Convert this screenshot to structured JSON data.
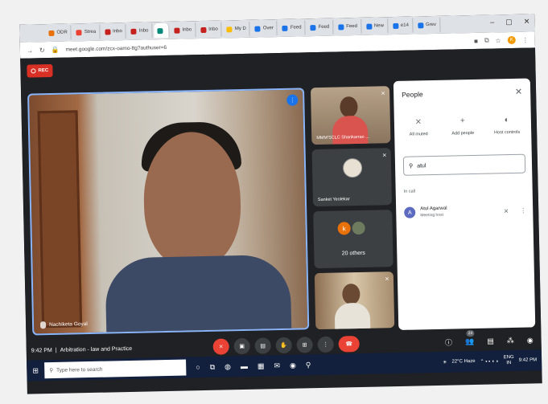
{
  "browser": {
    "tabs": [
      {
        "label": "ODR",
        "color": "#e8710a"
      },
      {
        "label": "Strea",
        "color": "#ea4335"
      },
      {
        "label": "Inbo",
        "color": "#c5221f"
      },
      {
        "label": "Inbo",
        "color": "#c5221f"
      },
      {
        "label": "",
        "color": "#00897b",
        "active": true
      },
      {
        "label": "Inbo",
        "color": "#c5221f"
      },
      {
        "label": "Inbo",
        "color": "#c5221f"
      },
      {
        "label": "My D",
        "color": "#fbbc04"
      },
      {
        "label": "Over",
        "color": "#1a73e8"
      },
      {
        "label": "Feed",
        "color": "#1a73e8"
      },
      {
        "label": "Feed",
        "color": "#1a73e8"
      },
      {
        "label": "Feed",
        "color": "#1a73e8"
      },
      {
        "label": "New",
        "color": "#1a73e8"
      },
      {
        "label": "e14",
        "color": "#1a73e8"
      },
      {
        "label": "Grev",
        "color": "#1a73e8"
      }
    ],
    "url": "meet.google.com/zcx-oamo-ttg?authuser=6",
    "profile_initial": "K"
  },
  "meet": {
    "rec_label": "REC",
    "main_tile_name": "Nachiketa Goyal",
    "side_tiles": [
      {
        "name": "MMM'SCLC Shankarrao ..."
      },
      {
        "name": "Sanket Yeolekar"
      },
      {
        "count_label": "20 others",
        "initial": "k"
      },
      {
        "name": ""
      }
    ],
    "meeting_time": "9:42 PM",
    "meeting_title": "Arbitration - law and Practice",
    "participants_count": "24"
  },
  "people_panel": {
    "title": "People",
    "actions": [
      {
        "label": "All muted",
        "icon": "mic-off-icon"
      },
      {
        "label": "Add people",
        "icon": "add-person-icon"
      },
      {
        "label": "Host controls",
        "icon": "toggle-icon"
      }
    ],
    "search_value": "atul",
    "section_label": "In call",
    "people": [
      {
        "initial": "A",
        "name": "Atul Agarwal",
        "role": "Meeting host"
      }
    ]
  },
  "taskbar": {
    "search_placeholder": "Type here to search",
    "weather": "22°C Haze",
    "lang_top": "ENG",
    "lang_bottom": "IN",
    "time": "9:42 PM"
  }
}
